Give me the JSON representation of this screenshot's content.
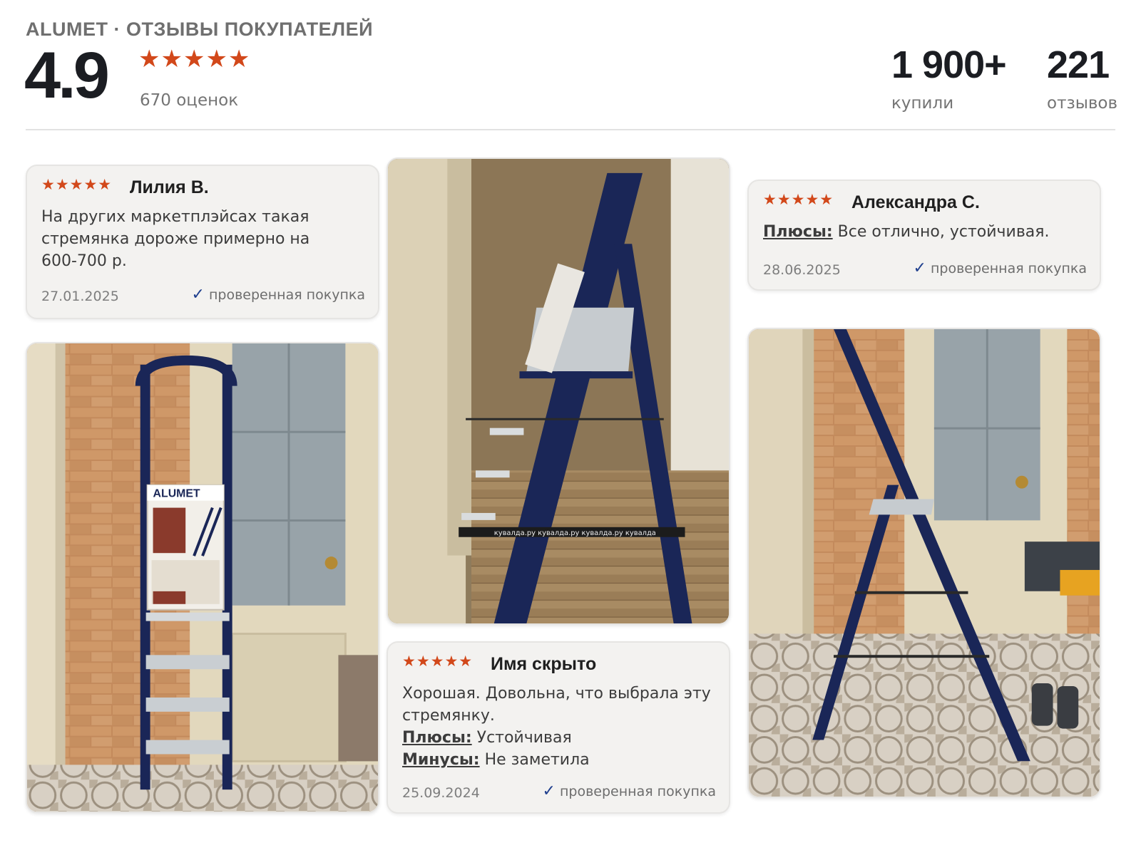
{
  "header": {
    "brand_line": "ALUMET · ОТЗЫВЫ ПОКУПАТЕЛЕЙ",
    "rating": "4.9",
    "stars": "★★★★★",
    "ratings_count": "670 оценок",
    "bought_value": "1 900+",
    "bought_label": "купили",
    "reviews_value": "221",
    "reviews_label": "отзывов"
  },
  "reviews": [
    {
      "stars": "★★★★★",
      "author": "Лилия В.",
      "text": "На других маркетплэйсах такая стремянка дороже примерно на 600-700 р.",
      "date": "27.01.2025",
      "verified": "проверенная покупка"
    },
    {
      "stars": "★★★★★",
      "author": "Имя скрыто",
      "text": "Хорошая. Довольна, что выбрала эту стремянку.",
      "pros_label": "Плюсы:",
      "pros": "Устойчивая",
      "cons_label": "Минусы:",
      "cons": "Не заметила",
      "date": "25.09.2024",
      "verified": "проверенная покупка"
    },
    {
      "stars": "★★★★★",
      "author": "Александра С.",
      "pros_label": "Плюсы:",
      "pros": "Все отлично, устойчивая.",
      "date": "28.06.2025",
      "verified": "проверенная покупка"
    }
  ],
  "photos": {
    "photo1_brand": "ALUMET",
    "tape_text": "кувалда.ру  кувалда.ру  кувалда.ру  кувалда"
  },
  "colors": {
    "accent_star": "#d2481a",
    "check": "#1e3f8e",
    "card_bg": "#f3f2f0",
    "ladder": "#1a2657"
  }
}
